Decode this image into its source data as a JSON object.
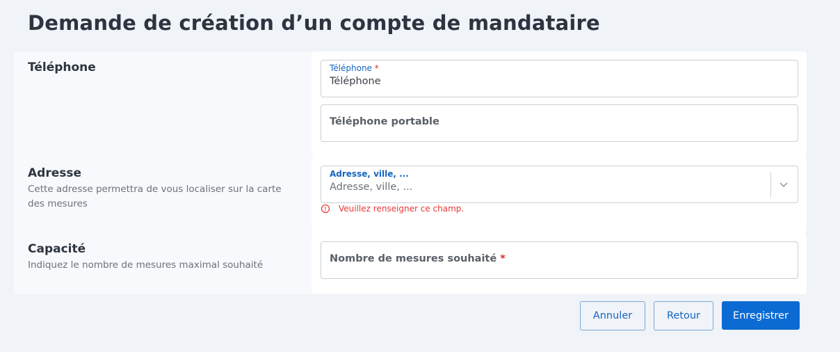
{
  "page": {
    "title": "Demande de création d’un compte de mandataire"
  },
  "sections": {
    "telephone": {
      "title": "Téléphone",
      "phone_field": {
        "label": "Téléphone",
        "required_mark": "*",
        "value": "Téléphone"
      },
      "mobile_field": {
        "placeholder": "Téléphone portable"
      }
    },
    "adresse": {
      "title": "Adresse",
      "description": "Cette adresse permettra de vous localiser sur la carte des mesures",
      "address_field": {
        "label": "Adresse, ville, ...",
        "placeholder": "Adresse, ville, ..."
      },
      "error": "Veuillez renseigner ce champ."
    },
    "capacite": {
      "title": "Capacité",
      "description": "Indiquez le nombre de mesures maximal souhaité",
      "count_field": {
        "placeholder": "Nombre de mesures souhaité",
        "required_mark": "*"
      }
    }
  },
  "actions": {
    "cancel": "Annuler",
    "back": "Retour",
    "save": "Enregistrer"
  },
  "colors": {
    "accent": "#0b6bd3",
    "error": "#e53935",
    "label": "#1565c0"
  }
}
